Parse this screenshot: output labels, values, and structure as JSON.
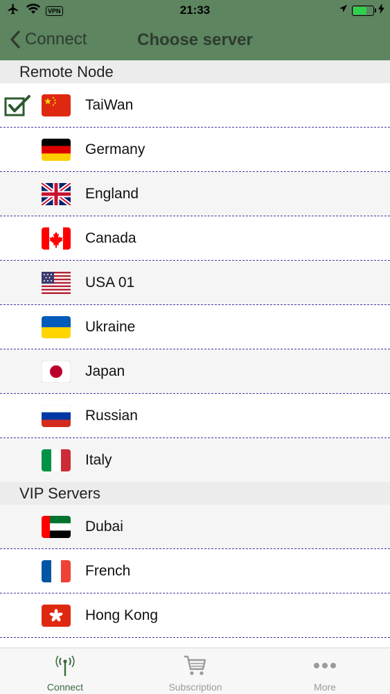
{
  "status_bar": {
    "time": "21:33",
    "vpn": "VPN"
  },
  "nav": {
    "back_label": "Connect",
    "title": "Choose server"
  },
  "sections": [
    {
      "title": "Remote Node",
      "servers": [
        {
          "name": "TaiWan",
          "flag": "china-flag-icon",
          "selected": true
        },
        {
          "name": "Germany",
          "flag": "germany-flag-icon",
          "selected": false
        },
        {
          "name": "England",
          "flag": "uk-flag-icon",
          "selected": false
        },
        {
          "name": "Canada",
          "flag": "canada-flag-icon",
          "selected": false
        },
        {
          "name": "USA 01",
          "flag": "usa-flag-icon",
          "selected": false
        },
        {
          "name": "Ukraine",
          "flag": "ukraine-flag-icon",
          "selected": false
        },
        {
          "name": "Japan",
          "flag": "japan-flag-icon",
          "selected": false
        },
        {
          "name": "Russian",
          "flag": "russia-flag-icon",
          "selected": false
        },
        {
          "name": "Italy",
          "flag": "italy-flag-icon",
          "selected": false
        }
      ]
    },
    {
      "title": "VIP Servers",
      "servers": [
        {
          "name": "Dubai",
          "flag": "uae-flag-icon",
          "selected": false
        },
        {
          "name": "French",
          "flag": "france-flag-icon",
          "selected": false
        },
        {
          "name": "Hong Kong",
          "flag": "hongkong-flag-icon",
          "selected": false
        }
      ]
    }
  ],
  "tabs": [
    {
      "label": "Connect",
      "icon": "antenna-icon",
      "active": true
    },
    {
      "label": "Subscription",
      "icon": "cart-icon",
      "active": false
    },
    {
      "label": "More",
      "icon": "more-dots-icon",
      "active": false
    }
  ],
  "colors": {
    "header_green": "#5d8560",
    "nav_text": "#2e3b2f",
    "separator": "#3b3ba6",
    "tab_active": "#3a6a3d",
    "tab_inactive": "#9a9a9a"
  }
}
